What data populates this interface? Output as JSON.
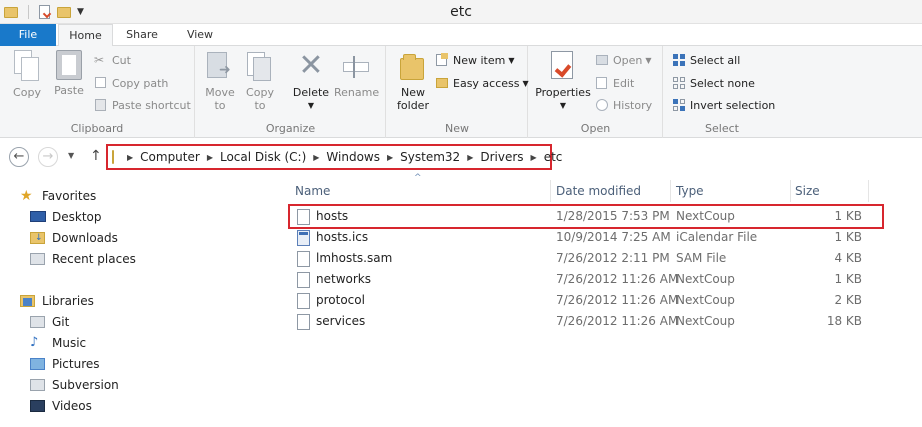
{
  "window": {
    "title": "etc"
  },
  "tabs": {
    "file": "File",
    "home": "Home",
    "share": "Share",
    "view": "View"
  },
  "ribbon": {
    "clipboard": {
      "label": "Clipboard",
      "copy": "Copy",
      "paste": "Paste",
      "cut": "Cut",
      "copy_path": "Copy path",
      "paste_shortcut": "Paste shortcut"
    },
    "organize": {
      "label": "Organize",
      "move_to_1": "Move",
      "move_to_2": "to",
      "copy_to_1": "Copy",
      "copy_to_2": "to",
      "delete": "Delete",
      "rename": "Rename"
    },
    "new": {
      "label": "New",
      "new_folder_1": "New",
      "new_folder_2": "folder",
      "new_item": "New item",
      "easy_access": "Easy access"
    },
    "open": {
      "label": "Open",
      "properties": "Properties",
      "open": "Open",
      "edit": "Edit",
      "history": "History"
    },
    "select": {
      "label": "Select",
      "select_all": "Select all",
      "select_none": "Select none",
      "invert_selection": "Invert selection"
    }
  },
  "address": {
    "crumbs": [
      "Computer",
      "Local Disk (C:)",
      "Windows",
      "System32",
      "Drivers",
      "etc"
    ]
  },
  "navpane": {
    "favorites": {
      "label": "Favorites",
      "items": [
        "Desktop",
        "Downloads",
        "Recent places"
      ]
    },
    "libraries": {
      "label": "Libraries",
      "items": [
        "Git",
        "Music",
        "Pictures",
        "Subversion",
        "Videos"
      ]
    }
  },
  "filelist": {
    "columns": {
      "name": "Name",
      "date": "Date modified",
      "type": "Type",
      "size": "Size"
    },
    "rows": [
      {
        "name": "hosts",
        "date": "1/28/2015 7:53 PM",
        "type": "NextCoup",
        "size": "1 KB",
        "icon": "file-icon"
      },
      {
        "name": "hosts.ics",
        "date": "10/9/2014 7:25 AM",
        "type": "iCalendar File",
        "size": "1 KB",
        "icon": "calendar-file-icon"
      },
      {
        "name": "lmhosts.sam",
        "date": "7/26/2012 2:11 PM",
        "type": "SAM File",
        "size": "4 KB",
        "icon": "file-icon"
      },
      {
        "name": "networks",
        "date": "7/26/2012 11:26 AM",
        "type": "NextCoup",
        "size": "1 KB",
        "icon": "file-icon"
      },
      {
        "name": "protocol",
        "date": "7/26/2012 11:26 AM",
        "type": "NextCoup",
        "size": "2 KB",
        "icon": "file-icon"
      },
      {
        "name": "services",
        "date": "7/26/2012 11:26 AM",
        "type": "NextCoup",
        "size": "18 KB",
        "icon": "file-icon"
      }
    ]
  },
  "colors": {
    "accent": "#1979ca",
    "highlight": "#d7262e",
    "folder": "#e9c46a"
  }
}
